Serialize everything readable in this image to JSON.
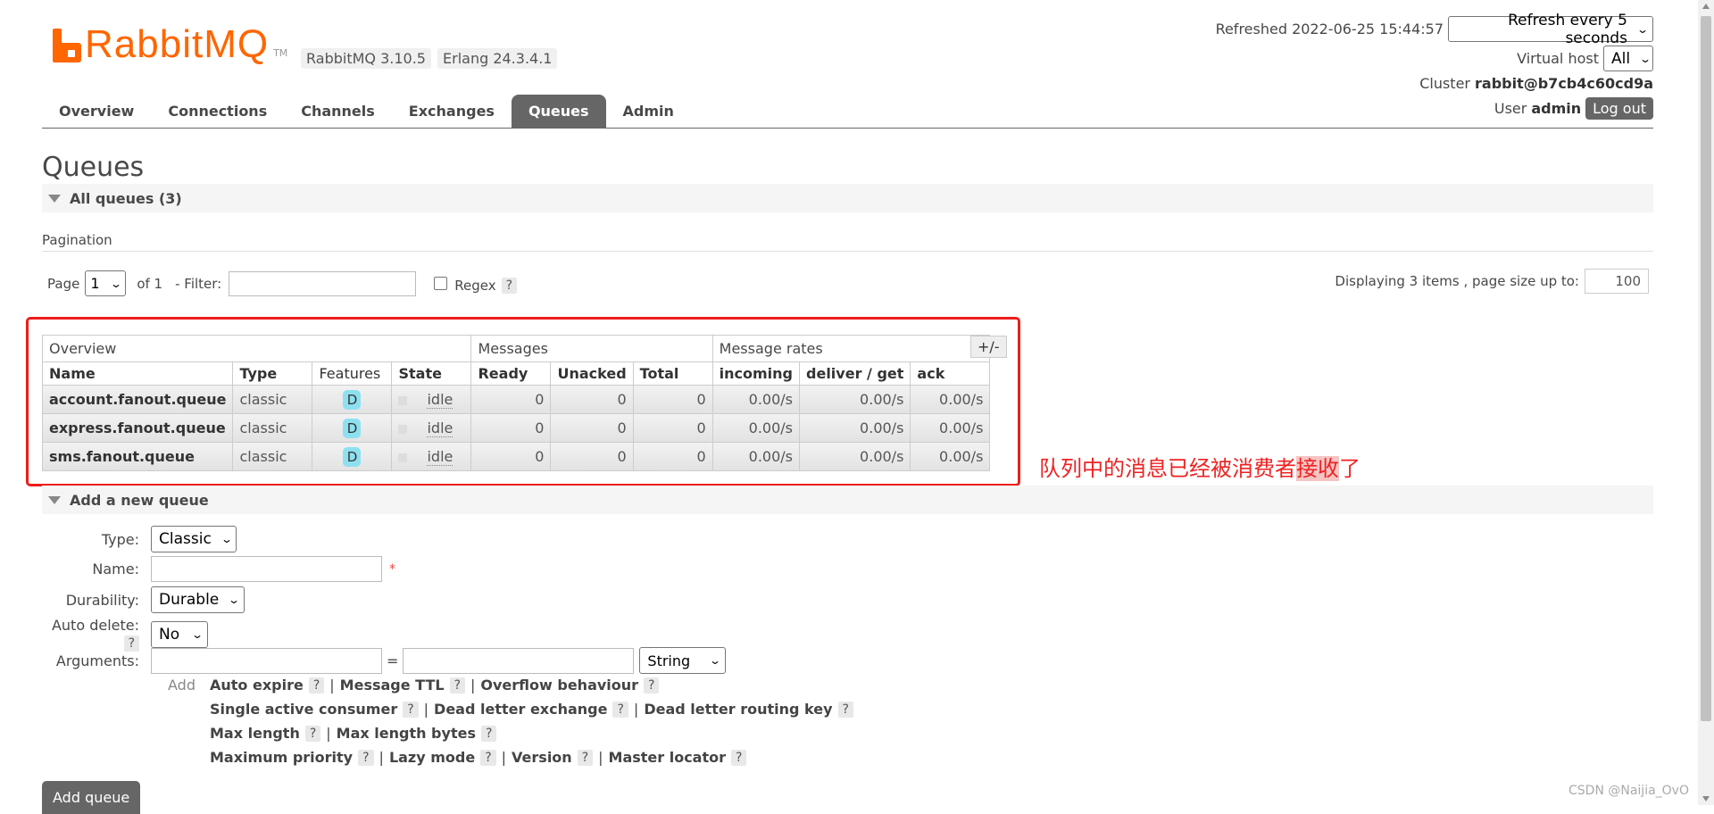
{
  "brand": {
    "name": "RabbitMQ",
    "tm": "TM",
    "color": "#ff6600"
  },
  "versions": {
    "rabbitmq": "RabbitMQ 3.10.5",
    "erlang": "Erlang 24.3.4.1"
  },
  "header": {
    "refreshed": "Refreshed 2022-06-25 15:44:57",
    "refresh_option": "Refresh every 5 seconds",
    "virtual_host_label": "Virtual host",
    "virtual_host_value": "All",
    "cluster_label": "Cluster",
    "cluster_value": "rabbit@b7cb4c60cd9a",
    "user_label": "User",
    "user_value": "admin",
    "logout_label": "Log out"
  },
  "tabs": [
    {
      "label": "Overview"
    },
    {
      "label": "Connections"
    },
    {
      "label": "Channels"
    },
    {
      "label": "Exchanges"
    },
    {
      "label": "Queues",
      "active": true
    },
    {
      "label": "Admin"
    }
  ],
  "page_title": "Queues",
  "all_queues_section": "All queues (3)",
  "pagination": {
    "label": "Pagination",
    "page_label": "Page",
    "page_value": "1",
    "of_label": "of 1",
    "filter_label": "- Filter:",
    "filter_value": "",
    "regex_label": "Regex",
    "help": "?",
    "displaying": "Displaying 3 items , page size up to:",
    "page_size": "100"
  },
  "table": {
    "groups": [
      "Overview",
      "Messages",
      "Message rates"
    ],
    "columns": [
      "Name",
      "Type",
      "Features",
      "State",
      "Ready",
      "Unacked",
      "Total",
      "incoming",
      "deliver / get",
      "ack"
    ],
    "plus_minus": "+/-",
    "rows": [
      {
        "name": "account.fanout.queue",
        "type": "classic",
        "feature": "D",
        "state": "idle",
        "ready": "0",
        "unacked": "0",
        "total": "0",
        "incoming": "0.00/s",
        "deliver": "0.00/s",
        "ack": "0.00/s"
      },
      {
        "name": "express.fanout.queue",
        "type": "classic",
        "feature": "D",
        "state": "idle",
        "ready": "0",
        "unacked": "0",
        "total": "0",
        "incoming": "0.00/s",
        "deliver": "0.00/s",
        "ack": "0.00/s"
      },
      {
        "name": "sms.fanout.queue",
        "type": "classic",
        "feature": "D",
        "state": "idle",
        "ready": "0",
        "unacked": "0",
        "total": "0",
        "incoming": "0.00/s",
        "deliver": "0.00/s",
        "ack": "0.00/s"
      }
    ]
  },
  "annotation": {
    "prefix": "队列中的消息已经被消费者",
    "highlight": "接收",
    "suffix": "了",
    "color": "#ee2222"
  },
  "add_queue_section": "Add a new queue",
  "form": {
    "type_label": "Type:",
    "type_value": "Classic",
    "name_label": "Name:",
    "name_value": "",
    "required_mark": "*",
    "durability_label": "Durability:",
    "durability_value": "Durable",
    "auto_delete_label": "Auto delete:",
    "auto_delete_value": "No",
    "arguments_label": "Arguments:",
    "arg_eq": "=",
    "arg_type_value": "String",
    "add_label": "Add",
    "arg_rows": [
      [
        "Auto expire",
        "Message TTL",
        "Overflow behaviour"
      ],
      [
        "Single active consumer",
        "Dead letter exchange",
        "Dead letter routing key"
      ],
      [
        "Max length",
        "Max length bytes"
      ],
      [
        "Maximum priority",
        "Lazy mode",
        "Version",
        "Master locator"
      ]
    ],
    "separator": "|",
    "help": "?",
    "submit_label": "Add queue"
  },
  "watermark": "CSDN @Naijia_OvO"
}
